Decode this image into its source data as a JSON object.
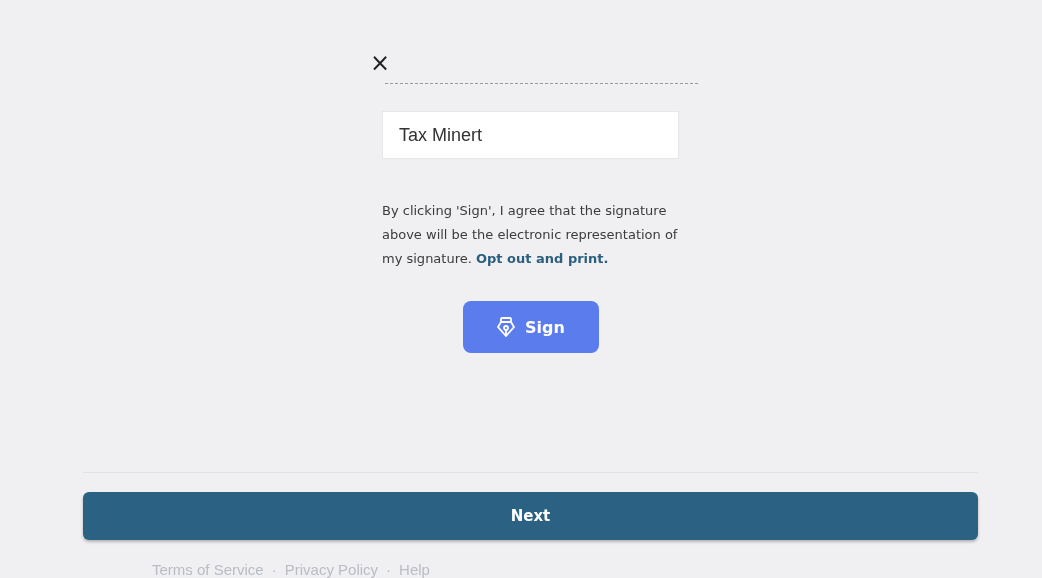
{
  "signature_panel": {
    "close": "×",
    "name_input": {
      "value": "Tax Minert"
    },
    "consent_text": "By clicking 'Sign', I agree that the signature above will be the electronic representation of my signature.",
    "opt_out_link": "Opt out and print.",
    "sign_button": "Sign"
  },
  "next_button": "Next",
  "footer": {
    "links": [
      "Terms of Service",
      "Privacy Policy",
      "Help"
    ],
    "separator": "·"
  }
}
